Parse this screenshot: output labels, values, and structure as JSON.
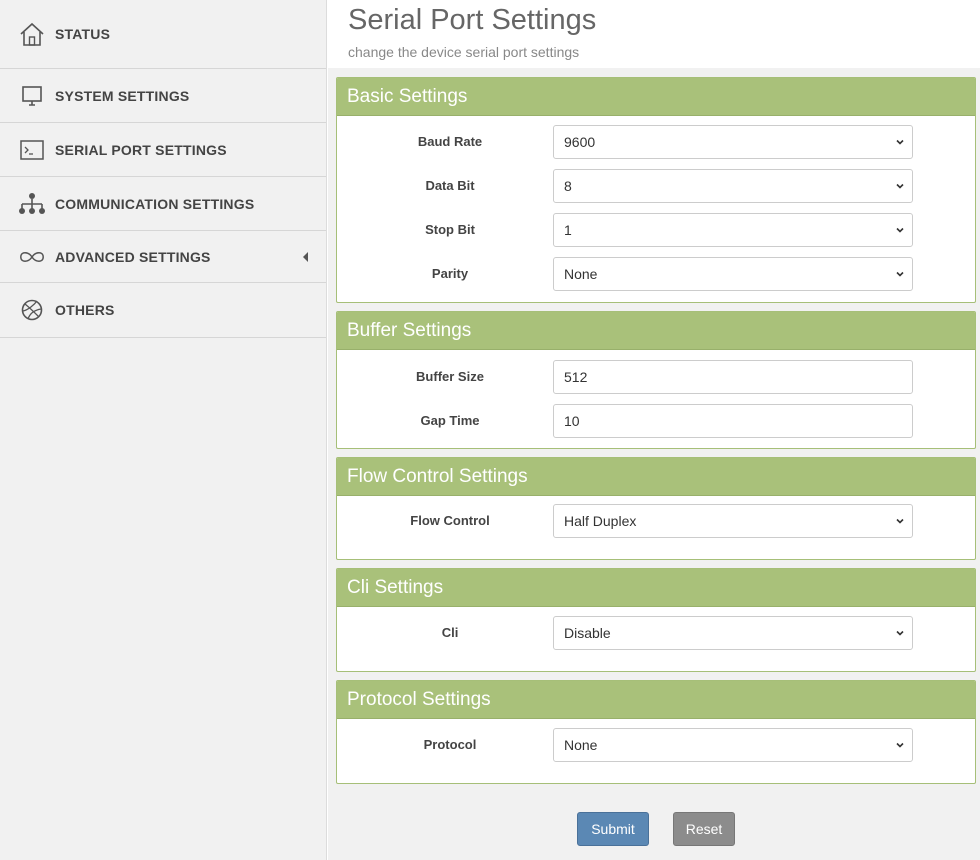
{
  "sidebar": {
    "items": [
      {
        "label": "STATUS",
        "icon": "home-icon"
      },
      {
        "label": "SYSTEM SETTINGS",
        "icon": "monitor-icon"
      },
      {
        "label": "SERIAL PORT SETTINGS",
        "icon": "terminal-icon"
      },
      {
        "label": "COMMUNICATION SETTINGS",
        "icon": "network-icon"
      },
      {
        "label": "ADVANCED SETTINGS",
        "icon": "infinity-icon"
      },
      {
        "label": "OTHERS",
        "icon": "globe-icon"
      }
    ]
  },
  "header": {
    "title": "Serial Port Settings",
    "subtitle": "change the device serial port settings"
  },
  "panels": {
    "basic": {
      "title": "Basic Settings",
      "baud_rate": {
        "label": "Baud Rate",
        "value": "9600"
      },
      "data_bit": {
        "label": "Data Bit",
        "value": "8"
      },
      "stop_bit": {
        "label": "Stop Bit",
        "value": "1"
      },
      "parity": {
        "label": "Parity",
        "value": "None"
      }
    },
    "buffer": {
      "title": "Buffer Settings",
      "buffer_size": {
        "label": "Buffer Size",
        "value": "512"
      },
      "gap_time": {
        "label": "Gap Time",
        "value": "10"
      }
    },
    "flow": {
      "title": "Flow Control Settings",
      "flow_control": {
        "label": "Flow Control",
        "value": "Half Duplex"
      }
    },
    "cli": {
      "title": "Cli Settings",
      "cli": {
        "label": "Cli",
        "value": "Disable"
      }
    },
    "protocol": {
      "title": "Protocol Settings",
      "protocol": {
        "label": "Protocol",
        "value": "None"
      }
    }
  },
  "actions": {
    "submit_label": "Submit",
    "reset_label": "Reset"
  },
  "colors": {
    "panel_header": "#a9c17a",
    "submit": "#5b88b4",
    "reset": "#8c8c8c"
  }
}
